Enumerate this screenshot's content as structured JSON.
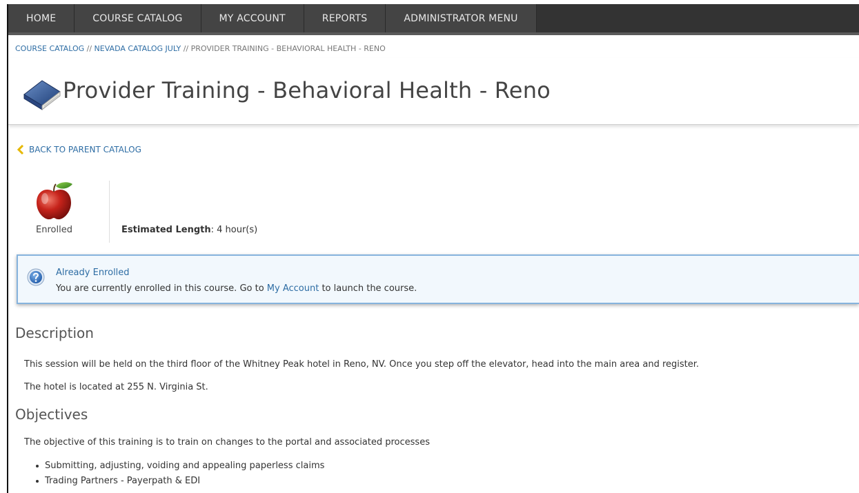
{
  "nav": {
    "items": [
      {
        "label": "HOME"
      },
      {
        "label": "COURSE CATALOG"
      },
      {
        "label": "MY ACCOUNT"
      },
      {
        "label": "REPORTS"
      },
      {
        "label": "ADMINISTRATOR MENU"
      }
    ]
  },
  "breadcrumb": {
    "items": [
      {
        "label": "COURSE CATALOG"
      },
      {
        "label": "NEVADA CATALOG JULY"
      },
      {
        "label": "PROVIDER TRAINING - BEHAVIORAL HEALTH - RENO"
      }
    ],
    "separator": "//"
  },
  "page": {
    "title": "Provider Training - Behavioral Health - Reno",
    "title_icon": "book-icon",
    "back_label": "BACK TO PARENT CATALOG"
  },
  "status": {
    "label": "Enrolled",
    "icon": "apple-icon",
    "estimated_length_label": "Estimated Length",
    "estimated_length_value": ": 4 hour(s)"
  },
  "notice": {
    "title": "Already Enrolled",
    "text_before": "You are currently enrolled in this course. Go to ",
    "link_label": "My Account",
    "text_after": " to launch the course.",
    "icon": "help-icon"
  },
  "description": {
    "heading": "Description",
    "paragraphs": [
      "This session will be held on the third floor of the Whitney Peak hotel in Reno, NV. Once you step off the elevator, head into the main area and register.",
      "The hotel is located at 255 N. Virginia St."
    ]
  },
  "objectives": {
    "heading": "Objectives",
    "intro": "The objective of this training is to train on changes to the portal and associated processes",
    "bullets": [
      "Submitting, adjusting, voiding and appealing paperless claims",
      "Trading Partners - Payerpath & EDI"
    ]
  },
  "colors": {
    "nav_bg": "#444444",
    "link": "#2e6da4",
    "notice_border": "#86b3dd",
    "back_chevron": "#e6b800"
  }
}
